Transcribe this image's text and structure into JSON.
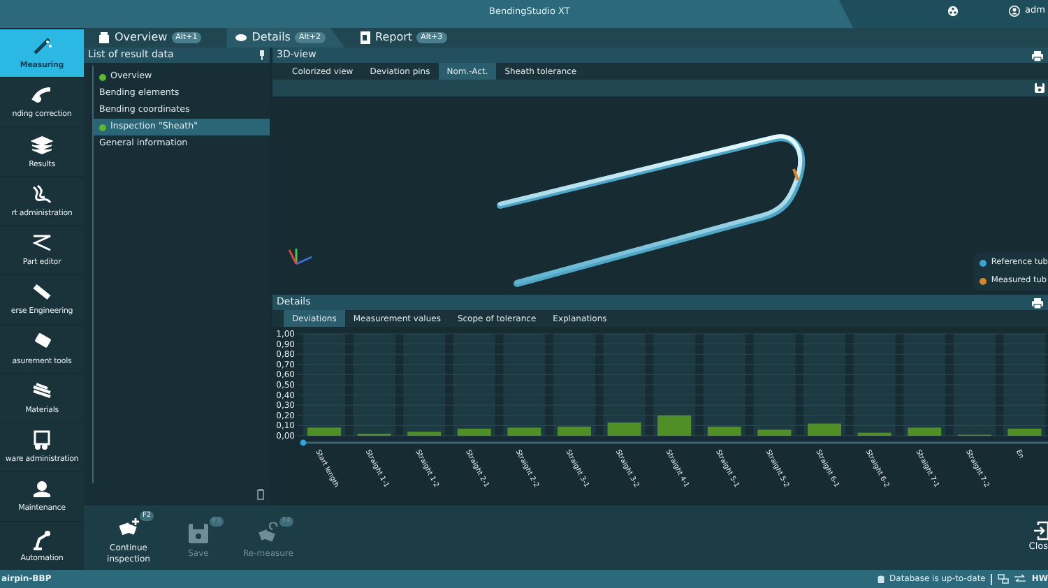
{
  "window": {
    "title": "BendingStudio XT",
    "user": "adm"
  },
  "main_tabs": [
    {
      "label": "Overview",
      "shortcut": "Alt+1",
      "selected": false
    },
    {
      "label": "Details",
      "shortcut": "Alt+2",
      "selected": true
    },
    {
      "label": "Report",
      "shortcut": "Alt+3",
      "selected": false
    }
  ],
  "sidebar": {
    "items": [
      {
        "label": "Measuring",
        "selected": true
      },
      {
        "label": "nding correction",
        "selected": false
      },
      {
        "label": "Results",
        "selected": false
      },
      {
        "label": "rt administration",
        "selected": false
      },
      {
        "label": "Part editor",
        "selected": false
      },
      {
        "label": "erse Engineering",
        "selected": false
      },
      {
        "label": "asurement tools",
        "selected": false
      },
      {
        "label": "Materials",
        "selected": false
      },
      {
        "label": "ware administration",
        "selected": false
      },
      {
        "label": "Maintenance",
        "selected": false
      },
      {
        "label": "Automation",
        "selected": false
      }
    ]
  },
  "result_list": {
    "title": "List of result data",
    "items": [
      {
        "label": "Overview",
        "color": "#5cb82e",
        "selected": false
      },
      {
        "label": "Bending elements",
        "selected": false
      },
      {
        "label": "Bending coordinates",
        "selected": false
      },
      {
        "label": "Inspection \"Sheath\"",
        "color": "#5cb82e",
        "selected": true
      },
      {
        "label": "General information",
        "selected": false
      }
    ]
  },
  "view_3d": {
    "title": "3D-view",
    "tabs": [
      {
        "label": "Colorized view",
        "selected": false
      },
      {
        "label": "Deviation pins",
        "selected": false
      },
      {
        "label": "Nom.-Act.",
        "selected": true
      },
      {
        "label": "Sheath tolerance",
        "selected": false
      }
    ],
    "legend": [
      {
        "label": "Reference tub",
        "color": "#3ba3d4"
      },
      {
        "label": "Measured tub",
        "color": "#d9862b"
      }
    ]
  },
  "details": {
    "title": "Details",
    "tabs": [
      {
        "label": "Deviations",
        "selected": true
      },
      {
        "label": "Measurement values",
        "selected": false
      },
      {
        "label": "Scope of tolerance",
        "selected": false
      },
      {
        "label": "Explanations",
        "selected": false
      }
    ],
    "chart_data": {
      "type": "bar",
      "categories": [
        "Start length",
        "Straight 1-1",
        "Straight 1-2",
        "Straight 2-1",
        "Straight 2-2",
        "Straight 3-1",
        "Straight 3-2",
        "Straight 4-1",
        "Straight 5-1",
        "Straight 5-2",
        "Straight 6-1",
        "Straight 6-2",
        "Straight 7-1",
        "Straight 7-2",
        "En"
      ],
      "series": [
        {
          "color": "#4f8f25",
          "values": [
            0.08,
            0.02,
            0.04,
            0.07,
            0.08,
            0.09,
            0.13,
            0.2,
            0.09,
            0.06,
            0.12,
            0.03,
            0.08,
            0.01,
            0.07
          ]
        }
      ],
      "grid": true,
      "ylim": [
        0,
        1
      ],
      "yticks": [
        {
          "value": 0,
          "label": "0,00"
        },
        {
          "value": 0.1,
          "label": "0,10"
        },
        {
          "value": 0.2,
          "label": "0,20"
        },
        {
          "value": 0.3,
          "label": "0,30"
        },
        {
          "value": 0.4,
          "label": "0,40"
        },
        {
          "value": 0.5,
          "label": "0,50"
        },
        {
          "value": 0.6,
          "label": "0,60"
        },
        {
          "value": 0.7,
          "label": "0,70"
        },
        {
          "value": 0.8,
          "label": "0,80"
        },
        {
          "value": 0.9,
          "label": "0,90"
        },
        {
          "value": 1,
          "label": "1,00"
        }
      ]
    }
  },
  "actions": [
    {
      "label": "Continue inspection",
      "key": "F2",
      "disabled": false
    },
    {
      "label": "Save",
      "key": "F3",
      "disabled": true
    },
    {
      "label": "Re-measure",
      "key": "F4",
      "disabled": true
    }
  ],
  "close": {
    "label": "Clos"
  },
  "status_bar": {
    "project": "airpin-BBP",
    "database": "Database is up-to-date",
    "hw": "HW"
  }
}
